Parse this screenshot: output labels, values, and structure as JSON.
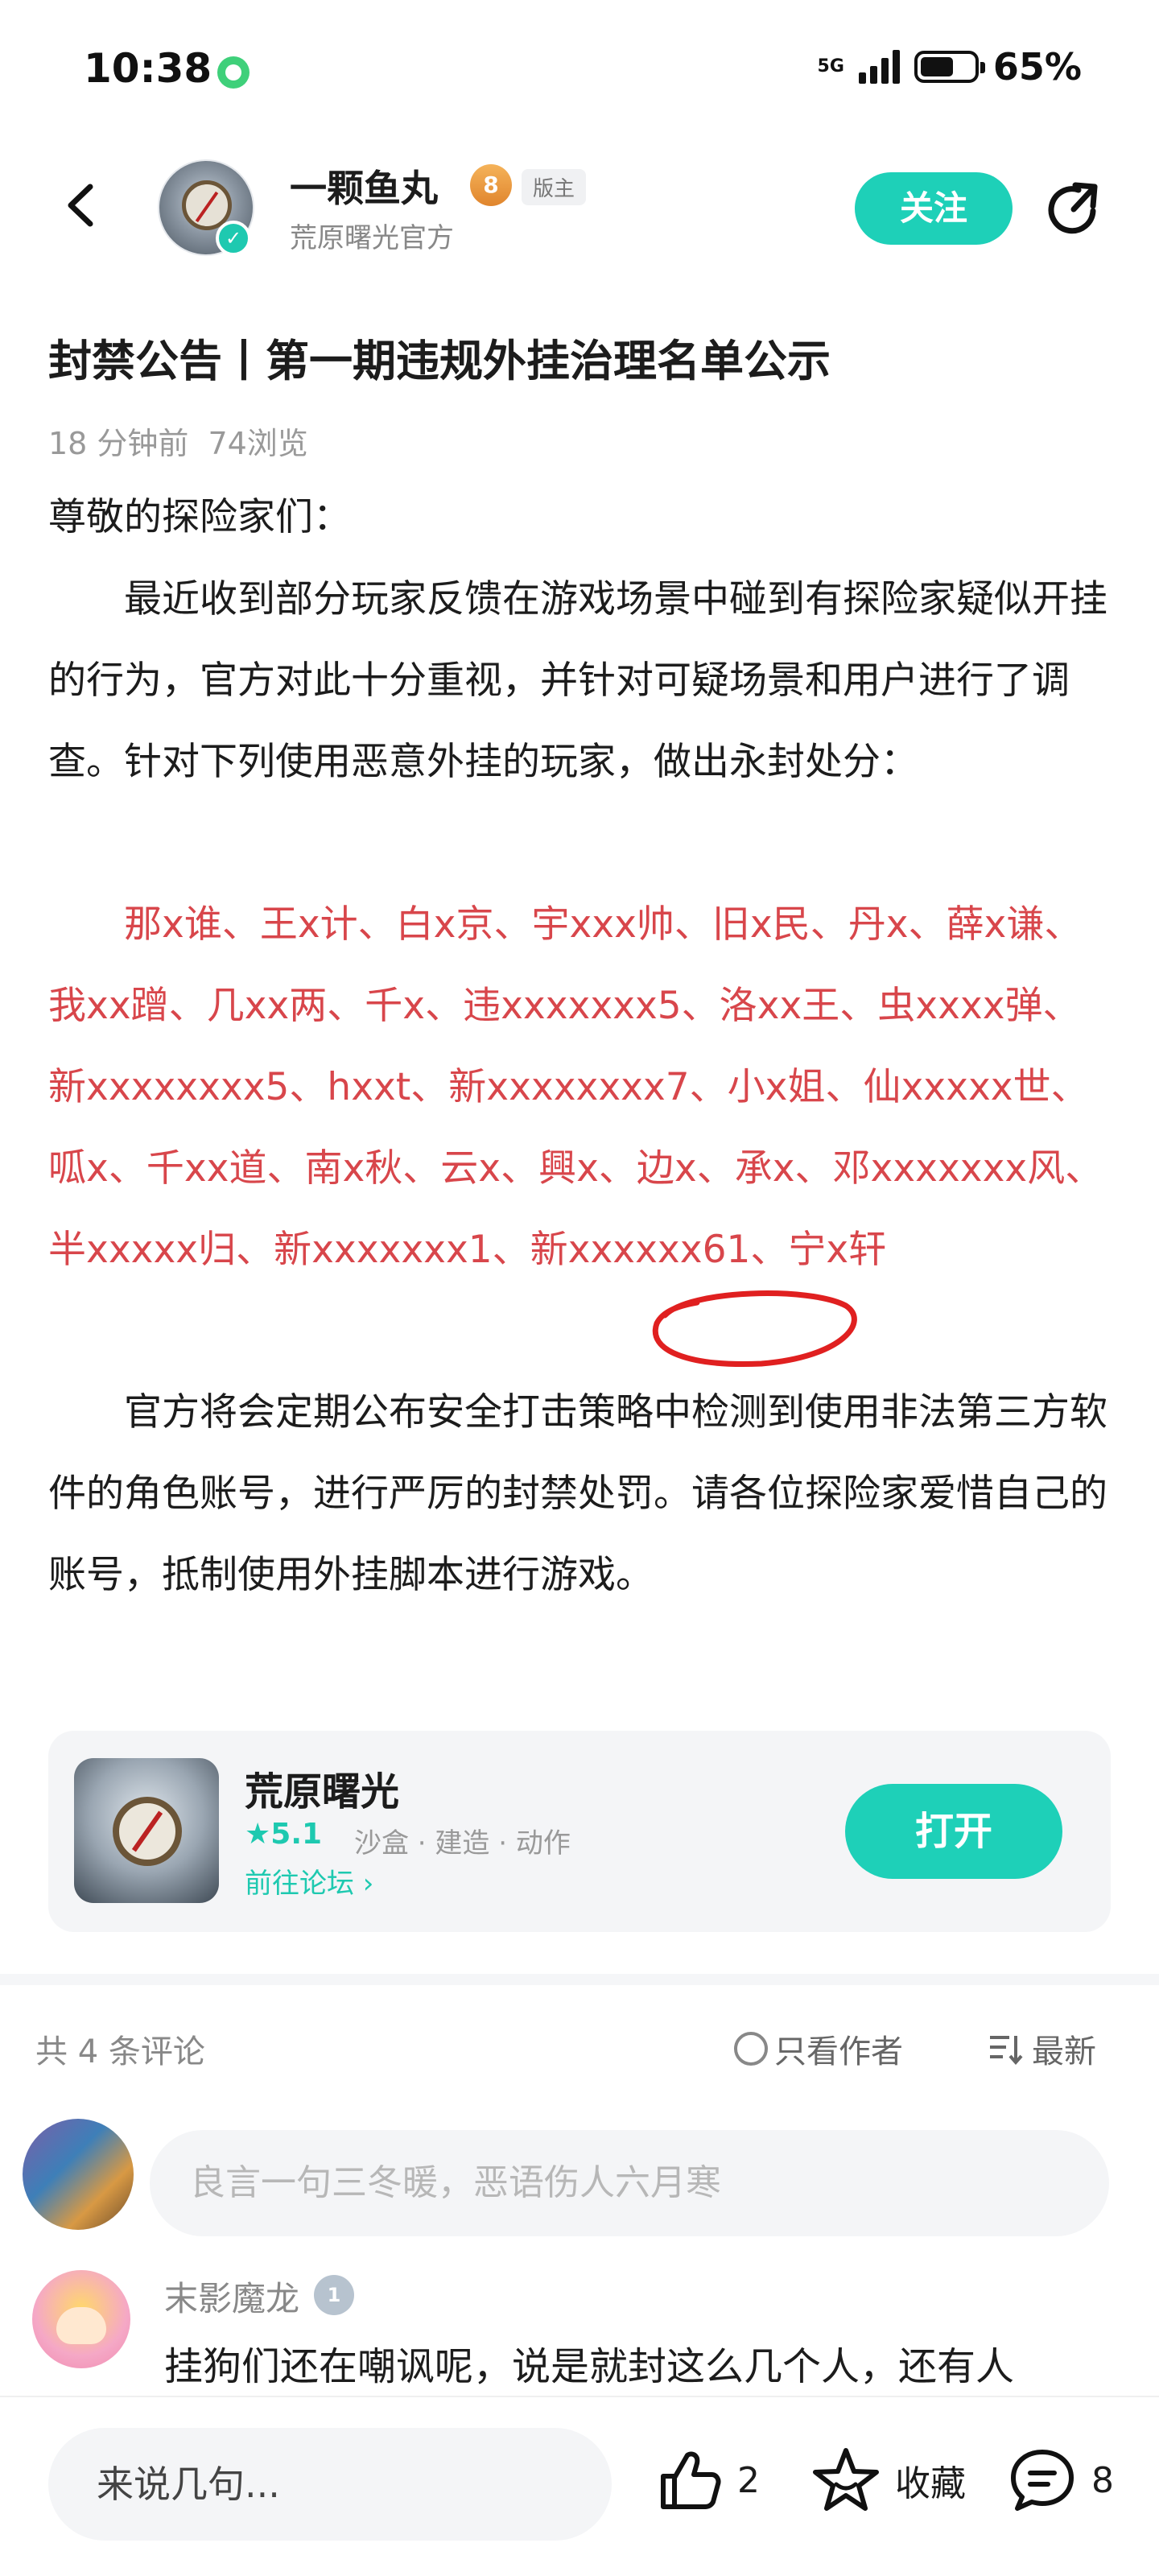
{
  "status_bar": {
    "time": "10:38",
    "network": "5G",
    "battery": "65%"
  },
  "header": {
    "author_name": "一颗鱼丸",
    "level_badge": "8",
    "role_tag": "版主",
    "author_subtitle": "荒原曙光官方",
    "follow_label": "关注"
  },
  "post": {
    "title": "封禁公告丨第一期违规外挂治理名单公示",
    "time_ago": "18 分钟前",
    "views": "74浏览",
    "greeting": "尊敬的探险家们：",
    "paragraph1": "　　最近收到部分玩家反馈在游戏场景中碰到有探险家疑似开挂的行为，官方对此十分重视，并针对可疑场景和用户进行了调查。针对下列使用恶意外挂的玩家，做出永封处分：",
    "banned_list": "　　那x谁、王x计、白x京、宇xxx帅、旧x民、丹x、薛x谦、我xx蹭、几xx两、千x、违xxxxxxx5、洛xx王、虫xxxx弹、新xxxxxxxx5、hxxt、新xxxxxxxx7、小x姐、仙xxxxx世、呱x、千xx道、南x秋、云x、興x、边x、承x、邓xxxxxxx风、半xxxxx归、新xxxxxxx1、新xxxxxx61、宁x轩",
    "paragraph2": "　　官方将会定期公布安全打击策略中检测到使用非法第三方软件的角色账号，进行严厉的封禁处罚。请各位探险家爱惜自己的账号，抵制使用外挂脚本进行游戏。"
  },
  "app_card": {
    "name": "荒原曙光",
    "rating": "★5.1",
    "tags": "沙盒 · 建造 · 动作",
    "forum_link": "前往论坛 ›",
    "open_label": "打开"
  },
  "comments": {
    "count_label": "共 4 条评论",
    "only_author_label": "只看作者",
    "sort_label": "最新",
    "input_placeholder": "良言一句三冬暖，恶语伤人六月寒",
    "items": [
      {
        "name": "末影魔龙",
        "level": "1",
        "text": "挂狗们还在嘲讽呢，说是就封这么几个人，还有人"
      }
    ]
  },
  "bottom_bar": {
    "reply_placeholder": "来说几句...",
    "like_count": "2",
    "favorite_label": "收藏",
    "comment_count": "8"
  },
  "colors": {
    "accent": "#1ed0b8",
    "banned_red": "#d8464b",
    "annotation_red": "#e02020"
  },
  "icons": [
    "back-arrow-icon",
    "share-icon",
    "verified-icon",
    "thumbs-up-icon",
    "star-icon",
    "comment-bubble-icon",
    "sort-icon"
  ]
}
